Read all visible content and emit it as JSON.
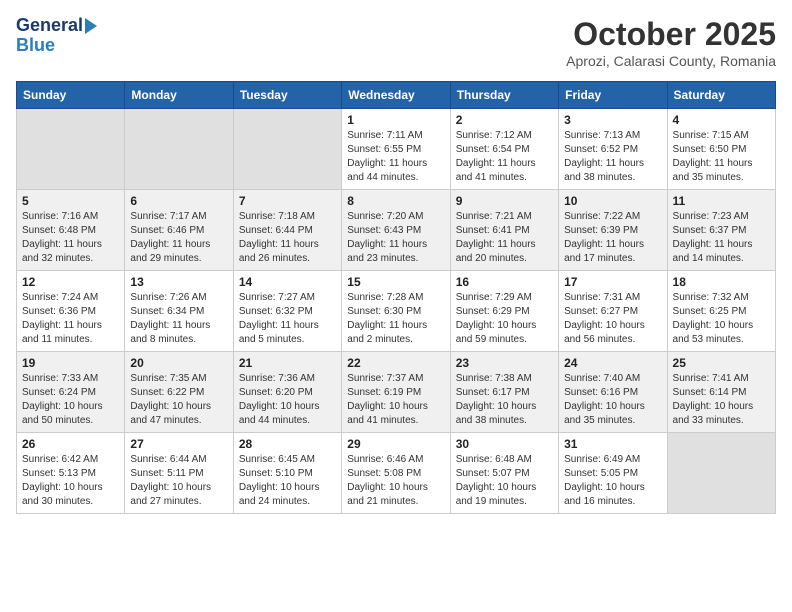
{
  "header": {
    "logo_line1": "General",
    "logo_line2": "Blue",
    "month": "October 2025",
    "location": "Aprozi, Calarasi County, Romania"
  },
  "weekdays": [
    "Sunday",
    "Monday",
    "Tuesday",
    "Wednesday",
    "Thursday",
    "Friday",
    "Saturday"
  ],
  "weeks": [
    {
      "days": [
        {
          "num": "",
          "info": ""
        },
        {
          "num": "",
          "info": ""
        },
        {
          "num": "",
          "info": ""
        },
        {
          "num": "1",
          "info": "Sunrise: 7:11 AM\nSunset: 6:55 PM\nDaylight: 11 hours and 44 minutes."
        },
        {
          "num": "2",
          "info": "Sunrise: 7:12 AM\nSunset: 6:54 PM\nDaylight: 11 hours and 41 minutes."
        },
        {
          "num": "3",
          "info": "Sunrise: 7:13 AM\nSunset: 6:52 PM\nDaylight: 11 hours and 38 minutes."
        },
        {
          "num": "4",
          "info": "Sunrise: 7:15 AM\nSunset: 6:50 PM\nDaylight: 11 hours and 35 minutes."
        }
      ]
    },
    {
      "days": [
        {
          "num": "5",
          "info": "Sunrise: 7:16 AM\nSunset: 6:48 PM\nDaylight: 11 hours and 32 minutes."
        },
        {
          "num": "6",
          "info": "Sunrise: 7:17 AM\nSunset: 6:46 PM\nDaylight: 11 hours and 29 minutes."
        },
        {
          "num": "7",
          "info": "Sunrise: 7:18 AM\nSunset: 6:44 PM\nDaylight: 11 hours and 26 minutes."
        },
        {
          "num": "8",
          "info": "Sunrise: 7:20 AM\nSunset: 6:43 PM\nDaylight: 11 hours and 23 minutes."
        },
        {
          "num": "9",
          "info": "Sunrise: 7:21 AM\nSunset: 6:41 PM\nDaylight: 11 hours and 20 minutes."
        },
        {
          "num": "10",
          "info": "Sunrise: 7:22 AM\nSunset: 6:39 PM\nDaylight: 11 hours and 17 minutes."
        },
        {
          "num": "11",
          "info": "Sunrise: 7:23 AM\nSunset: 6:37 PM\nDaylight: 11 hours and 14 minutes."
        }
      ]
    },
    {
      "days": [
        {
          "num": "12",
          "info": "Sunrise: 7:24 AM\nSunset: 6:36 PM\nDaylight: 11 hours and 11 minutes."
        },
        {
          "num": "13",
          "info": "Sunrise: 7:26 AM\nSunset: 6:34 PM\nDaylight: 11 hours and 8 minutes."
        },
        {
          "num": "14",
          "info": "Sunrise: 7:27 AM\nSunset: 6:32 PM\nDaylight: 11 hours and 5 minutes."
        },
        {
          "num": "15",
          "info": "Sunrise: 7:28 AM\nSunset: 6:30 PM\nDaylight: 11 hours and 2 minutes."
        },
        {
          "num": "16",
          "info": "Sunrise: 7:29 AM\nSunset: 6:29 PM\nDaylight: 10 hours and 59 minutes."
        },
        {
          "num": "17",
          "info": "Sunrise: 7:31 AM\nSunset: 6:27 PM\nDaylight: 10 hours and 56 minutes."
        },
        {
          "num": "18",
          "info": "Sunrise: 7:32 AM\nSunset: 6:25 PM\nDaylight: 10 hours and 53 minutes."
        }
      ]
    },
    {
      "days": [
        {
          "num": "19",
          "info": "Sunrise: 7:33 AM\nSunset: 6:24 PM\nDaylight: 10 hours and 50 minutes."
        },
        {
          "num": "20",
          "info": "Sunrise: 7:35 AM\nSunset: 6:22 PM\nDaylight: 10 hours and 47 minutes."
        },
        {
          "num": "21",
          "info": "Sunrise: 7:36 AM\nSunset: 6:20 PM\nDaylight: 10 hours and 44 minutes."
        },
        {
          "num": "22",
          "info": "Sunrise: 7:37 AM\nSunset: 6:19 PM\nDaylight: 10 hours and 41 minutes."
        },
        {
          "num": "23",
          "info": "Sunrise: 7:38 AM\nSunset: 6:17 PM\nDaylight: 10 hours and 38 minutes."
        },
        {
          "num": "24",
          "info": "Sunrise: 7:40 AM\nSunset: 6:16 PM\nDaylight: 10 hours and 35 minutes."
        },
        {
          "num": "25",
          "info": "Sunrise: 7:41 AM\nSunset: 6:14 PM\nDaylight: 10 hours and 33 minutes."
        }
      ]
    },
    {
      "days": [
        {
          "num": "26",
          "info": "Sunrise: 6:42 AM\nSunset: 5:13 PM\nDaylight: 10 hours and 30 minutes."
        },
        {
          "num": "27",
          "info": "Sunrise: 6:44 AM\nSunset: 5:11 PM\nDaylight: 10 hours and 27 minutes."
        },
        {
          "num": "28",
          "info": "Sunrise: 6:45 AM\nSunset: 5:10 PM\nDaylight: 10 hours and 24 minutes."
        },
        {
          "num": "29",
          "info": "Sunrise: 6:46 AM\nSunset: 5:08 PM\nDaylight: 10 hours and 21 minutes."
        },
        {
          "num": "30",
          "info": "Sunrise: 6:48 AM\nSunset: 5:07 PM\nDaylight: 10 hours and 19 minutes."
        },
        {
          "num": "31",
          "info": "Sunrise: 6:49 AM\nSunset: 5:05 PM\nDaylight: 10 hours and 16 minutes."
        },
        {
          "num": "",
          "info": ""
        }
      ]
    }
  ]
}
